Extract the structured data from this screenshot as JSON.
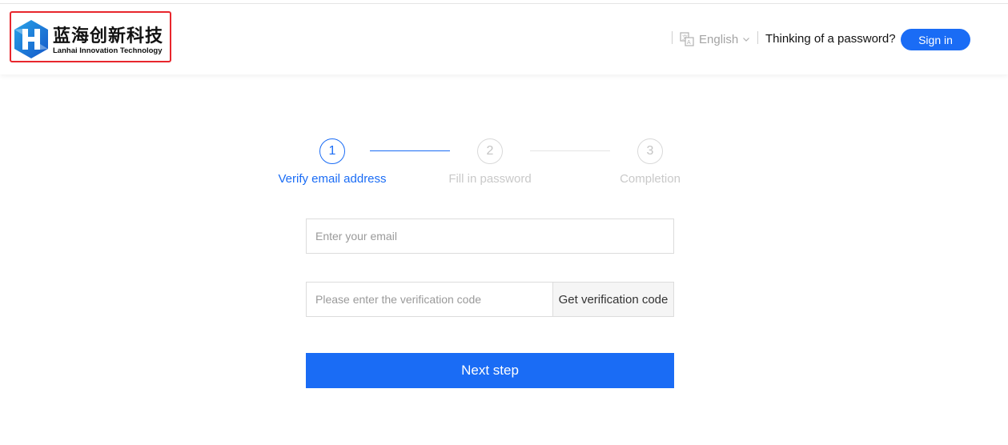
{
  "brand": {
    "name_cn": "蓝海创新科技",
    "name_en": "Lanhai Innovation Technology",
    "logo_icon": "hexagon-h-logo-icon",
    "highlight_color": "#e8262d"
  },
  "header": {
    "language": {
      "label": "English",
      "icon": "translate-icon",
      "chevron": "chevron-down-icon"
    },
    "prompt": "Thinking of a password?",
    "sign_in_label": "Sign in"
  },
  "steps": [
    {
      "number": "1",
      "label": "Verify email address",
      "state": "active"
    },
    {
      "number": "2",
      "label": "Fill in password",
      "state": "inactive"
    },
    {
      "number": "3",
      "label": "Completion",
      "state": "inactive"
    }
  ],
  "form": {
    "email_placeholder": "Enter your email",
    "code_placeholder": "Please enter the verification code",
    "get_code_label": "Get verification code",
    "next_label": "Next step"
  },
  "colors": {
    "primary": "#1a6cf5",
    "inactive": "#c9c9c9",
    "border": "#dcdcdc"
  }
}
